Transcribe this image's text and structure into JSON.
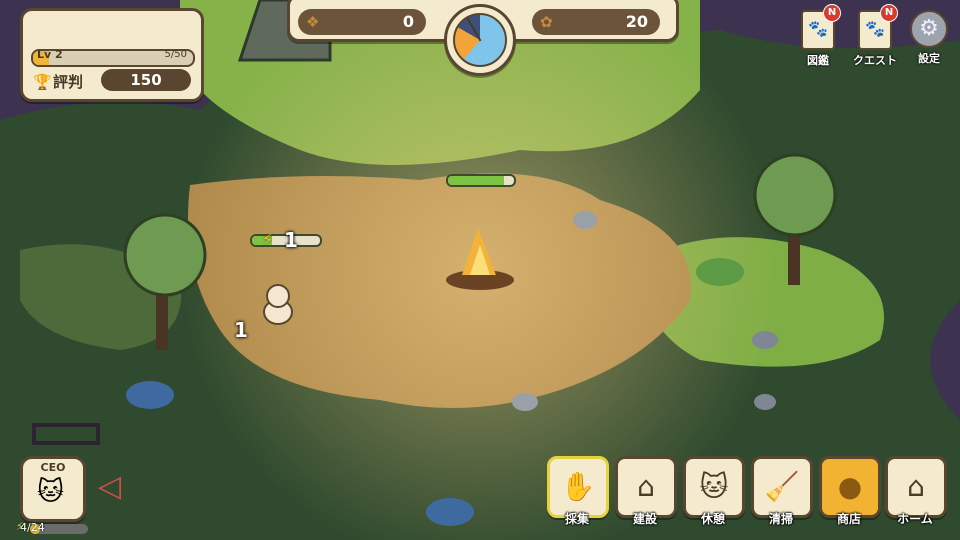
{
  "stats": {
    "level_label": "Lv 2",
    "level_progress": "5/50",
    "level_fraction": 0.1,
    "reputation_label": "評判",
    "reputation_value": "150"
  },
  "resources": {
    "left_value": "0",
    "right_value": "20",
    "left_icon": "pinecone-icon",
    "right_icon": "acorn-icon"
  },
  "top_menu": {
    "zukan": "図鑑",
    "quest": "クエスト",
    "settings": "設定",
    "badge": "N"
  },
  "world": {
    "fire_progress": 0.85,
    "cat_stamina": 0.3,
    "cat_stamina_value": "1",
    "gather_count": "1"
  },
  "ceo": {
    "label": "CEO",
    "count": "4/24",
    "stamina_fraction": 0.17
  },
  "actions": {
    "gather": "採集",
    "build": "建設",
    "rest": "休憩",
    "clean": "清掃",
    "shop": "商店",
    "home": "ホーム"
  },
  "colors": {
    "panel": "#f4ebcf",
    "panel_border": "#5a4630",
    "accent_gold": "#f0b43a",
    "progress_green": "#7cc243",
    "arrow_red": "#d84a4a"
  }
}
